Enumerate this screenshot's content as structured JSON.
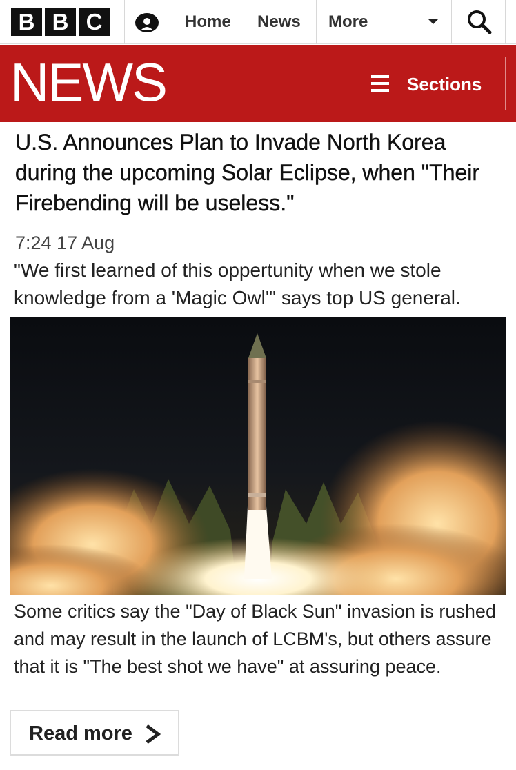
{
  "header": {
    "brand_letters": [
      "B",
      "B",
      "C"
    ],
    "nav": {
      "home": "Home",
      "news": "News",
      "more": "More"
    }
  },
  "news_bar": {
    "logo_text": "NEWS",
    "sections_label": "Sections",
    "color": "#bb1919"
  },
  "article": {
    "headline": "U.S. Announces Plan to Invade North Korea during the upcoming Solar Eclipse, when \"Their Firebending will be useless.\"",
    "timestamp": "7:24 17 Aug",
    "summary": "\"We first learned of this oppertunity when we stole knowledge from a 'Magic Owl'\" says top US general.",
    "body": "Some critics say the \"Day of Black Sun\" invasion is rushed and may result in the launch of LCBM's, but others assure that it is \"The best shot we have\" at assuring peace.",
    "read_more_label": "Read more"
  },
  "icons": {
    "account": "account-icon",
    "dropdown": "chevron-down-icon",
    "search": "search-icon",
    "menu": "hamburger-icon",
    "read_more": "chevron-right-icon"
  }
}
